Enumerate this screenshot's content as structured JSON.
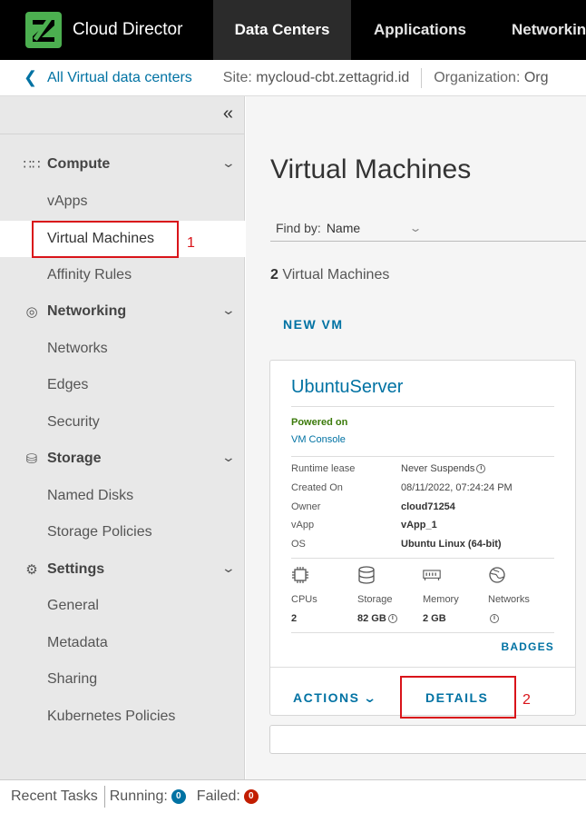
{
  "topnav": {
    "brand": "Cloud Director",
    "tabs": [
      {
        "label": "Data Centers",
        "active": true
      },
      {
        "label": "Applications",
        "active": false
      },
      {
        "label": "Networking",
        "active": false
      }
    ],
    "logo_color": "#4caf50"
  },
  "breadcrumb": {
    "back_label": "All Virtual data centers",
    "site_label": "Site:",
    "site_value": "mycloud-cbt.zettagrid.id",
    "org_label": "Organization:",
    "org_value": "Org"
  },
  "sidebar": {
    "collapse_icon": "double-chevron-left-icon",
    "sections": [
      {
        "label": "Compute",
        "icon": "compute-icon",
        "items": [
          "vApps",
          "Virtual Machines",
          "Affinity Rules"
        ]
      },
      {
        "label": "Networking",
        "icon": "network-icon",
        "items": [
          "Networks",
          "Edges",
          "Security"
        ]
      },
      {
        "label": "Storage",
        "icon": "storage-icon",
        "items": [
          "Named Disks",
          "Storage Policies"
        ]
      },
      {
        "label": "Settings",
        "icon": "gear-icon",
        "items": [
          "General",
          "Metadata",
          "Sharing",
          "Kubernetes Policies"
        ]
      }
    ],
    "active_item": "Virtual Machines"
  },
  "main": {
    "title": "Virtual Machines",
    "find_by_label": "Find by:",
    "find_by_value": "Name",
    "count_number": "2",
    "count_label": "Virtual Machines",
    "new_vm_label": "NEW VM"
  },
  "vm_card": {
    "name": "UbuntuServer",
    "status": "Powered on",
    "console_link": "VM Console",
    "properties": [
      {
        "key": "Runtime lease",
        "value": "Never Suspends",
        "info": true
      },
      {
        "key": "Created On",
        "value": "08/11/2022, 07:24:24 PM"
      },
      {
        "key": "Owner",
        "value": "cloud71254"
      },
      {
        "key": "vApp",
        "value": "vApp_1"
      },
      {
        "key": "OS",
        "value": "Ubuntu Linux (64-bit)"
      }
    ],
    "resources": [
      {
        "label": "CPUs",
        "value": "2",
        "icon": "cpu-icon"
      },
      {
        "label": "Storage",
        "value": "82 GB",
        "icon": "storage-icon",
        "info": true
      },
      {
        "label": "Memory",
        "value": "2 GB",
        "icon": "memory-icon"
      },
      {
        "label": "Networks",
        "value": "",
        "icon": "network-icon",
        "info": true
      }
    ],
    "badges_label": "BADGES",
    "actions_label": "ACTIONS",
    "details_label": "DETAILS"
  },
  "annotations": {
    "one": "1",
    "two": "2"
  },
  "bottombar": {
    "recent_tasks": "Recent Tasks",
    "running_label": "Running:",
    "running_count": "0",
    "failed_label": "Failed:",
    "failed_count": "0"
  }
}
